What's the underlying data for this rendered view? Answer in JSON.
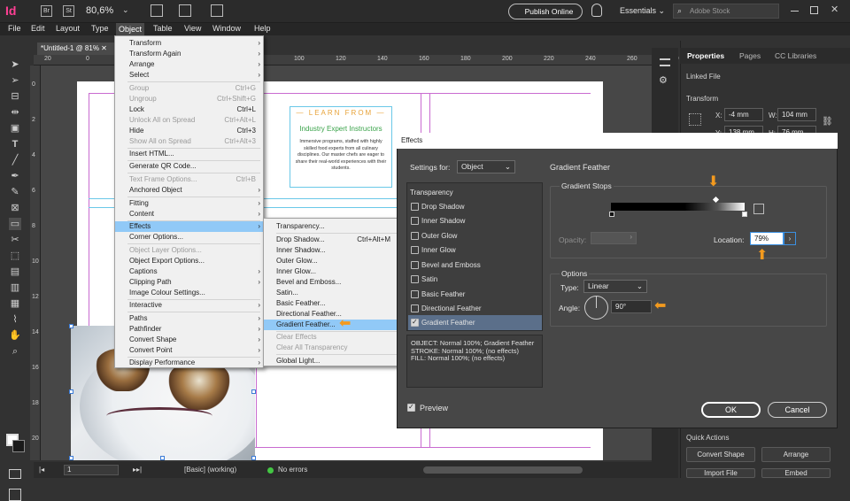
{
  "app": {
    "logo": "Id",
    "bridge_badge": "Br",
    "stock_badge": "St",
    "zoom": "80,6%",
    "publish_button": "Publish Online",
    "workspace": "Essentials",
    "search_placeholder": "Adobe Stock"
  },
  "menubar": [
    "File",
    "Edit",
    "Layout",
    "Type",
    "Object",
    "Table",
    "View",
    "Window",
    "Help"
  ],
  "document": {
    "tab_title": "*Untitled-1 @ 81%",
    "ruler_h": [
      "20",
      "0",
      "20",
      "40",
      "60",
      "80",
      "100",
      "120",
      "140",
      "160",
      "180",
      "200",
      "220",
      "240",
      "260",
      "280"
    ],
    "ruler_v": [
      "0",
      "2",
      "4",
      "6",
      "8",
      "10",
      "12",
      "14",
      "16",
      "18",
      "20"
    ],
    "flyer": {
      "kicker": "LEARN FROM",
      "title": "Industry Expert Instructors",
      "body": "Immersive programs, staffed with highly skilled food experts from all culinary disciplines. Our master chefs are eager to share their real-world experiences with their students."
    }
  },
  "status": {
    "page": "1",
    "style": "[Basic] (working)",
    "errors": "No errors"
  },
  "object_menu": [
    {
      "label": "Transform",
      "arrow": true
    },
    {
      "label": "Transform Again",
      "arrow": true
    },
    {
      "label": "Arrange",
      "arrow": true
    },
    {
      "label": "Select",
      "arrow": true
    },
    {
      "label": "Group",
      "shortcut": "Ctrl+G",
      "disabled": true
    },
    {
      "label": "Ungroup",
      "shortcut": "Ctrl+Shift+G",
      "disabled": true
    },
    {
      "label": "Lock",
      "shortcut": "Ctrl+L"
    },
    {
      "label": "Unlock All on Spread",
      "shortcut": "Ctrl+Alt+L",
      "disabled": true
    },
    {
      "label": "Hide",
      "shortcut": "Ctrl+3"
    },
    {
      "label": "Show All on Spread",
      "shortcut": "Ctrl+Alt+3",
      "disabled": true
    },
    {
      "label": "Insert HTML..."
    },
    {
      "label": "Generate QR Code..."
    },
    {
      "label": "Text Frame Options...",
      "shortcut": "Ctrl+B",
      "disabled": true
    },
    {
      "label": "Anchored Object",
      "arrow": true
    },
    {
      "label": "Fitting",
      "arrow": true
    },
    {
      "label": "Content",
      "arrow": true
    },
    {
      "label": "Effects",
      "arrow": true,
      "highlight": true
    },
    {
      "label": "Corner Options..."
    },
    {
      "label": "Object Layer Options...",
      "disabled": true
    },
    {
      "label": "Object Export Options..."
    },
    {
      "label": "Captions",
      "arrow": true
    },
    {
      "label": "Clipping Path",
      "arrow": true
    },
    {
      "label": "Image Colour Settings..."
    },
    {
      "label": "Interactive",
      "arrow": true
    },
    {
      "label": "Paths",
      "arrow": true
    },
    {
      "label": "Pathfinder",
      "arrow": true
    },
    {
      "label": "Convert Shape",
      "arrow": true
    },
    {
      "label": "Convert Point",
      "arrow": true
    },
    {
      "label": "Display Performance",
      "arrow": true
    }
  ],
  "effects_menu": [
    {
      "label": "Transparency..."
    },
    {
      "label": "Drop Shadow...",
      "shortcut": "Ctrl+Alt+M"
    },
    {
      "label": "Inner Shadow..."
    },
    {
      "label": "Outer Glow..."
    },
    {
      "label": "Inner Glow..."
    },
    {
      "label": "Bevel and Emboss..."
    },
    {
      "label": "Satin..."
    },
    {
      "label": "Basic Feather..."
    },
    {
      "label": "Directional Feather..."
    },
    {
      "label": "Gradient Feather...",
      "highlight": true
    },
    {
      "label": "Clear Effects",
      "disabled": true
    },
    {
      "label": "Clear All Transparency",
      "disabled": true
    },
    {
      "label": "Global Light..."
    }
  ],
  "dialog": {
    "title": "Effects",
    "settings_for_label": "Settings for:",
    "settings_for_value": "Object",
    "transparency_label": "Transparency",
    "effects": [
      {
        "label": "Drop Shadow",
        "checked": false
      },
      {
        "label": "Inner Shadow",
        "checked": false
      },
      {
        "label": "Outer Glow",
        "checked": false
      },
      {
        "label": "Inner Glow",
        "checked": false
      },
      {
        "label": "Bevel and Emboss",
        "checked": false
      },
      {
        "label": "Satin",
        "checked": false
      },
      {
        "label": "Basic Feather",
        "checked": false
      },
      {
        "label": "Directional Feather",
        "checked": false
      },
      {
        "label": "Gradient Feather",
        "checked": true
      }
    ],
    "info_lines": [
      "OBJECT: Normal 100%; Gradient Feather",
      "STROKE: Normal 100%; (no effects)",
      "FILL: Normal 100%; (no effects)"
    ],
    "section_title": "Gradient Feather",
    "stops_label": "Gradient Stops",
    "opacity_label": "Opacity:",
    "location_label": "Location:",
    "location_value": "79%",
    "options_label": "Options",
    "type_label": "Type:",
    "type_value": "Linear",
    "angle_label": "Angle:",
    "angle_value": "90°",
    "preview_label": "Preview",
    "preview_checked": true,
    "ok_label": "OK",
    "cancel_label": "Cancel"
  },
  "right_panel": {
    "tabs": [
      "Properties",
      "Pages",
      "CC Libraries"
    ],
    "linked_file": "Linked File",
    "transform": "Transform",
    "x_label": "X:",
    "x_value": "-4 mm",
    "w_label": "W:",
    "w_value": "104 mm",
    "y_label": "Y:",
    "y_value": "138 mm",
    "h_label": "H:",
    "h_value": "76 mm",
    "quick_actions": "Quick Actions",
    "btn_convert_shape": "Convert Shape",
    "btn_arrange": "Arrange",
    "btn_import": "Import File",
    "btn_embed": "Embed"
  },
  "colors": {
    "accent_orange": "#f39a1e",
    "highlight_blue": "#91c9f7",
    "flyer_orange": "#e8a33a",
    "flyer_green": "#3aa34a"
  }
}
